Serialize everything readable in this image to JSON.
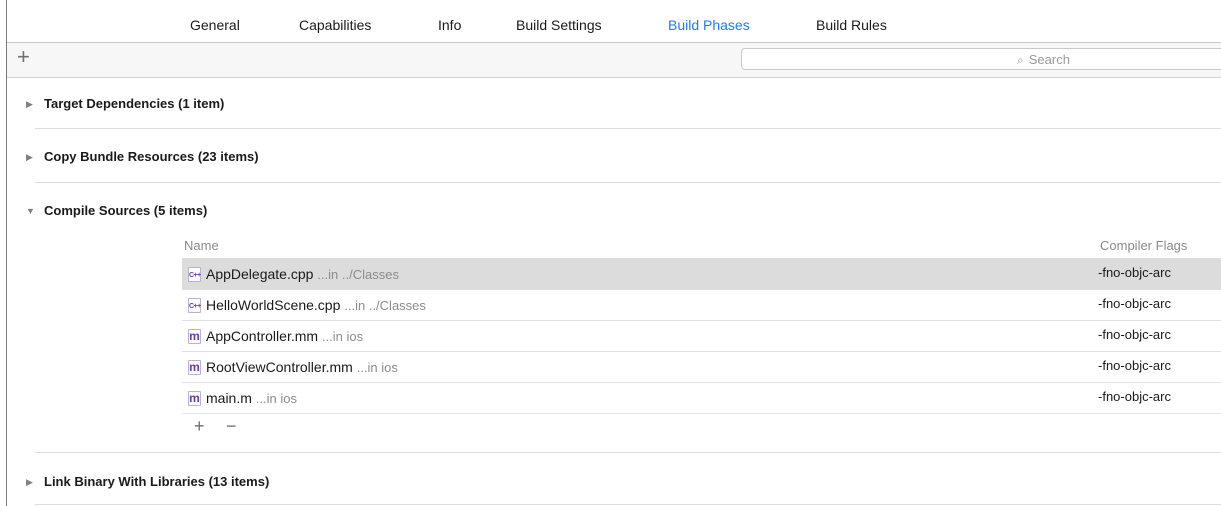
{
  "tabs": [
    {
      "label": "General"
    },
    {
      "label": "Capabilities"
    },
    {
      "label": "Info"
    },
    {
      "label": "Build Settings"
    },
    {
      "label": "Build Phases"
    },
    {
      "label": "Build Rules"
    }
  ],
  "active_tab": "Build Phases",
  "colors": {
    "accent": "#1e7cf2",
    "selection": "#dcdcdc",
    "filetype_icon": "#6a40a5"
  },
  "toolbar": {
    "add_label": "+",
    "search_placeholder": "Search",
    "search_icon": "magnifier-icon"
  },
  "phases": [
    {
      "title": "Target Dependencies (1 item)",
      "expanded": false
    },
    {
      "title": "Copy Bundle Resources (23 items)",
      "expanded": false
    },
    {
      "title": "Compile Sources (5 items)",
      "expanded": true
    },
    {
      "title": "Link Binary With Libraries (13 items)",
      "expanded": false
    }
  ],
  "compile_sources": {
    "columns": {
      "name": "Name",
      "flags": "Compiler Flags"
    },
    "rows": [
      {
        "icon": "cpp-file-icon",
        "icon_text": "C++",
        "name": "AppDelegate.cpp",
        "location": "...in ../Classes",
        "flags": "-fno-objc-arc",
        "selected": true
      },
      {
        "icon": "cpp-file-icon",
        "icon_text": "C++",
        "name": "HelloWorldScene.cpp",
        "location": "...in ../Classes",
        "flags": "-fno-objc-arc",
        "selected": false
      },
      {
        "icon": "objc-file-icon",
        "icon_text": "m",
        "name": "AppController.mm",
        "location": "...in ios",
        "flags": "-fno-objc-arc",
        "selected": false
      },
      {
        "icon": "objc-file-icon",
        "icon_text": "m",
        "name": "RootViewController.mm",
        "location": "...in ios",
        "flags": "-fno-objc-arc",
        "selected": false
      },
      {
        "icon": "objc-file-icon",
        "icon_text": "m",
        "name": "main.m",
        "location": "...in ios",
        "flags": "-fno-objc-arc",
        "selected": false
      }
    ],
    "add_label": "+",
    "remove_label": "−"
  }
}
